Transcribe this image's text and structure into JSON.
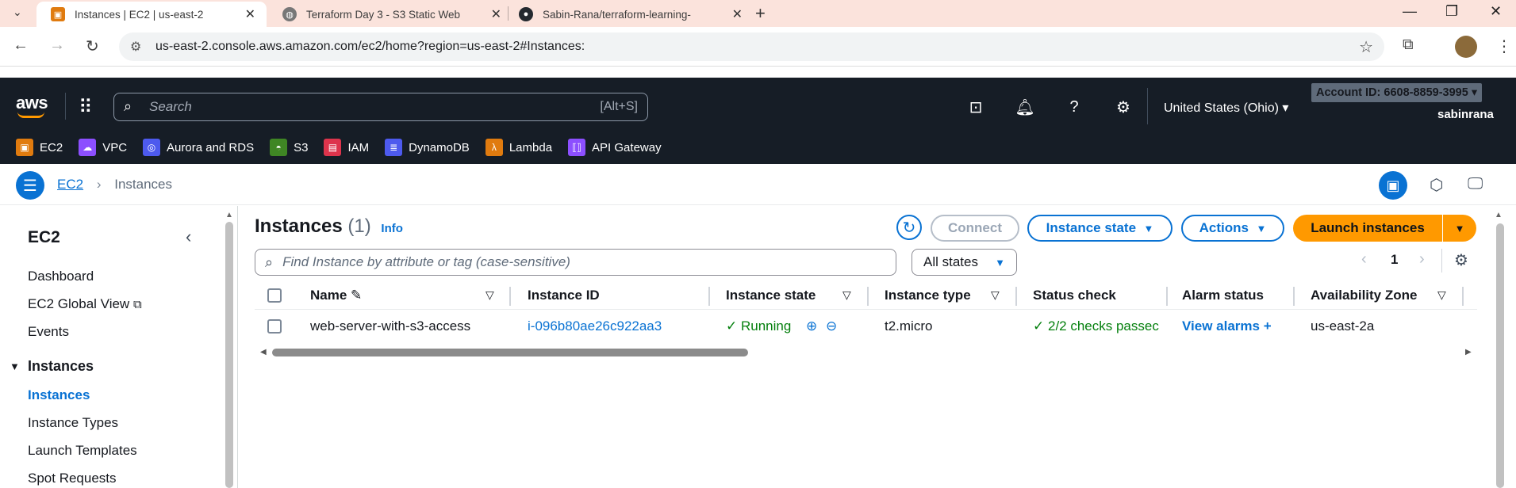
{
  "browser": {
    "tabs": [
      {
        "title": "Instances | EC2 | us-east-2",
        "active": true
      },
      {
        "title": "Terraform Day 3 - S3 Static Web",
        "active": false
      },
      {
        "title": "Sabin-Rana/terraform-learning-",
        "active": false
      }
    ],
    "url": "us-east-2.console.aws.amazon.com/ec2/home?region=us-east-2#Instances:"
  },
  "aws_header": {
    "logo": "aws",
    "search_placeholder": "Search",
    "search_shortcut": "[Alt+S]",
    "region": "United States (Ohio)",
    "account": "Account ID: 6608-8859-3995",
    "user": "sabinrana"
  },
  "favorites": [
    {
      "label": "EC2",
      "color": "#e07b0f"
    },
    {
      "label": "VPC",
      "color": "#8c4fff"
    },
    {
      "label": "Aurora and RDS",
      "color": "#4d5aee"
    },
    {
      "label": "S3",
      "color": "#3f8624"
    },
    {
      "label": "IAM",
      "color": "#dd344c"
    },
    {
      "label": "DynamoDB",
      "color": "#4d5aee"
    },
    {
      "label": "Lambda",
      "color": "#e07b0f"
    },
    {
      "label": "API Gateway",
      "color": "#8c4fff"
    }
  ],
  "breadcrumb": {
    "root": "EC2",
    "current": "Instances"
  },
  "sidebar": {
    "title": "EC2",
    "items": [
      "Dashboard",
      "EC2 Global View",
      "Events"
    ],
    "section": "Instances",
    "section_items": [
      "Instances",
      "Instance Types",
      "Launch Templates",
      "Spot Requests"
    ]
  },
  "main": {
    "title": "Instances",
    "count": "(1)",
    "info": "Info",
    "connect": "Connect",
    "instance_state_btn": "Instance state",
    "actions_btn": "Actions",
    "launch_btn": "Launch instances",
    "filter_placeholder": "Find Instance by attribute or tag (case-sensitive)",
    "states_select": "All states",
    "page": "1",
    "columns": [
      "Name",
      "Instance ID",
      "Instance state",
      "Instance type",
      "Status check",
      "Alarm status",
      "Availability Zone"
    ],
    "rows": [
      {
        "name": "web-server-with-s3-access",
        "id": "i-096b80ae26c922aa3",
        "state": "Running",
        "type": "t2.micro",
        "status": "2/2 checks passec",
        "alarm": "View alarms",
        "az": "us-east-2a"
      }
    ]
  },
  "colors": {
    "accent": "#0972d3",
    "launch": "#ff9900",
    "running": "#037f0c",
    "header": "#161d26"
  }
}
